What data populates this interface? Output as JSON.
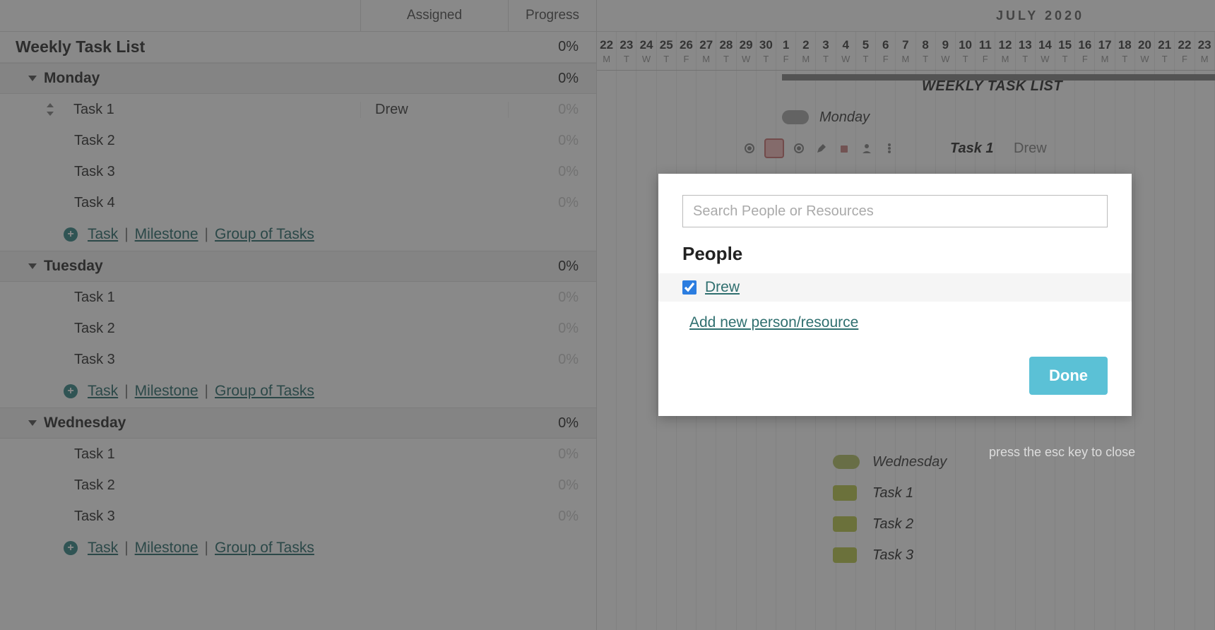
{
  "columns": {
    "assigned": "Assigned",
    "progress": "Progress"
  },
  "project": {
    "name": "Weekly Task List",
    "progress": "0%"
  },
  "groups": [
    {
      "name": "Monday",
      "progress": "0%",
      "tasks": [
        {
          "name": "Task 1",
          "assigned": "Drew",
          "progress": "0%"
        },
        {
          "name": "Task 2",
          "assigned": "",
          "progress": "0%"
        },
        {
          "name": "Task 3",
          "assigned": "",
          "progress": "0%"
        },
        {
          "name": "Task 4",
          "assigned": "",
          "progress": "0%"
        }
      ]
    },
    {
      "name": "Tuesday",
      "progress": "0%",
      "tasks": [
        {
          "name": "Task 1",
          "assigned": "",
          "progress": "0%"
        },
        {
          "name": "Task 2",
          "assigned": "",
          "progress": "0%"
        },
        {
          "name": "Task 3",
          "assigned": "",
          "progress": "0%"
        }
      ]
    },
    {
      "name": "Wednesday",
      "progress": "0%",
      "tasks": [
        {
          "name": "Task 1",
          "assigned": "",
          "progress": "0%"
        },
        {
          "name": "Task 2",
          "assigned": "",
          "progress": "0%"
        },
        {
          "name": "Task 3",
          "assigned": "",
          "progress": "0%"
        }
      ]
    }
  ],
  "add_links": {
    "task": "Task",
    "milestone": "Milestone",
    "group": "Group of Tasks"
  },
  "timeline": {
    "month_label": "JULY 2020",
    "days": [
      {
        "n": "22",
        "w": "M"
      },
      {
        "n": "23",
        "w": "T"
      },
      {
        "n": "24",
        "w": "W"
      },
      {
        "n": "25",
        "w": "T"
      },
      {
        "n": "26",
        "w": "F"
      },
      {
        "n": "27",
        "w": "M"
      },
      {
        "n": "28",
        "w": "T"
      },
      {
        "n": "29",
        "w": "W"
      },
      {
        "n": "30",
        "w": "T"
      },
      {
        "n": "1",
        "w": "F"
      },
      {
        "n": "2",
        "w": "M"
      },
      {
        "n": "3",
        "w": "T"
      },
      {
        "n": "4",
        "w": "W"
      },
      {
        "n": "5",
        "w": "T"
      },
      {
        "n": "6",
        "w": "F"
      },
      {
        "n": "7",
        "w": "M"
      },
      {
        "n": "8",
        "w": "T"
      },
      {
        "n": "9",
        "w": "W"
      },
      {
        "n": "10",
        "w": "T"
      },
      {
        "n": "11",
        "w": "F"
      },
      {
        "n": "12",
        "w": "M"
      },
      {
        "n": "13",
        "w": "T"
      },
      {
        "n": "14",
        "w": "W"
      },
      {
        "n": "15",
        "w": "T"
      },
      {
        "n": "16",
        "w": "F"
      },
      {
        "n": "17",
        "w": "M"
      },
      {
        "n": "18",
        "w": "T"
      },
      {
        "n": "20",
        "w": "W"
      },
      {
        "n": "21",
        "w": "T"
      },
      {
        "n": "22",
        "w": "F"
      },
      {
        "n": "23",
        "w": "M"
      }
    ],
    "project_label": "WEEKLY TASK LIST",
    "bars": {
      "monday": {
        "label": "Monday"
      },
      "task1": {
        "label": "Task 1",
        "assignee": "Drew"
      },
      "wednesday": {
        "label": "Wednesday"
      },
      "wed_tasks": [
        "Task 1",
        "Task 2",
        "Task 3"
      ]
    }
  },
  "modal": {
    "search_placeholder": "Search People or Resources",
    "people_heading": "People",
    "person_name": "Drew",
    "add_link": "Add new person/resource",
    "done": "Done"
  },
  "esc_hint": "press the esc key to close"
}
